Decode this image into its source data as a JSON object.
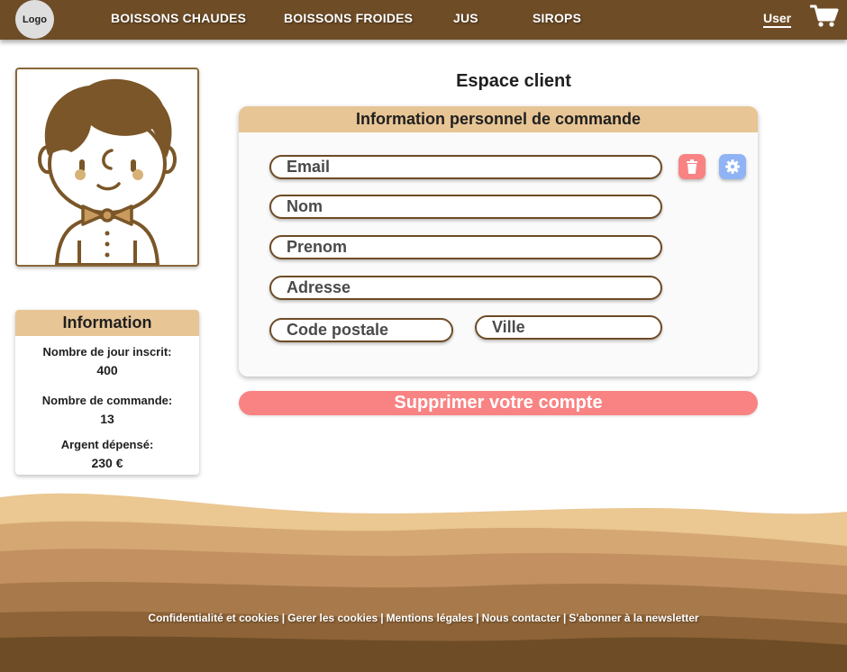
{
  "nav": {
    "logo": "Logo",
    "links": [
      "BOISSONS CHAUDES",
      "BOISSONS FROIDES",
      "JUS",
      "SIROPS"
    ],
    "user": "User",
    "cart_icon": "cart-icon"
  },
  "sidebar": {
    "info_title": "Information",
    "days_label": "Nombre de jour inscrit:",
    "days_value": "400",
    "orders_label": "Nombre de commande:",
    "orders_value": "13",
    "spent_label": "Argent dépensé:",
    "spent_value": "230 €"
  },
  "main": {
    "title": "Espace client",
    "form_title": "Information personnel de commande",
    "placeholders": {
      "email": "Email",
      "nom": "Nom",
      "prenom": "Prenom",
      "adresse": "Adresse",
      "code_postale": "Code postale",
      "ville": "Ville"
    },
    "delete_account": "Supprimer votre compte"
  },
  "footer": {
    "links": [
      "Confidentialité et cookies",
      "Gerer les cookies",
      "Mentions légales",
      "Nous contacter",
      "S'abonner à la newsletter"
    ],
    "separator": "|"
  },
  "colors": {
    "nav": "#6e4c26",
    "accent": "#e8c595",
    "danger": "#f98383",
    "settings": "#8fb3f5"
  }
}
